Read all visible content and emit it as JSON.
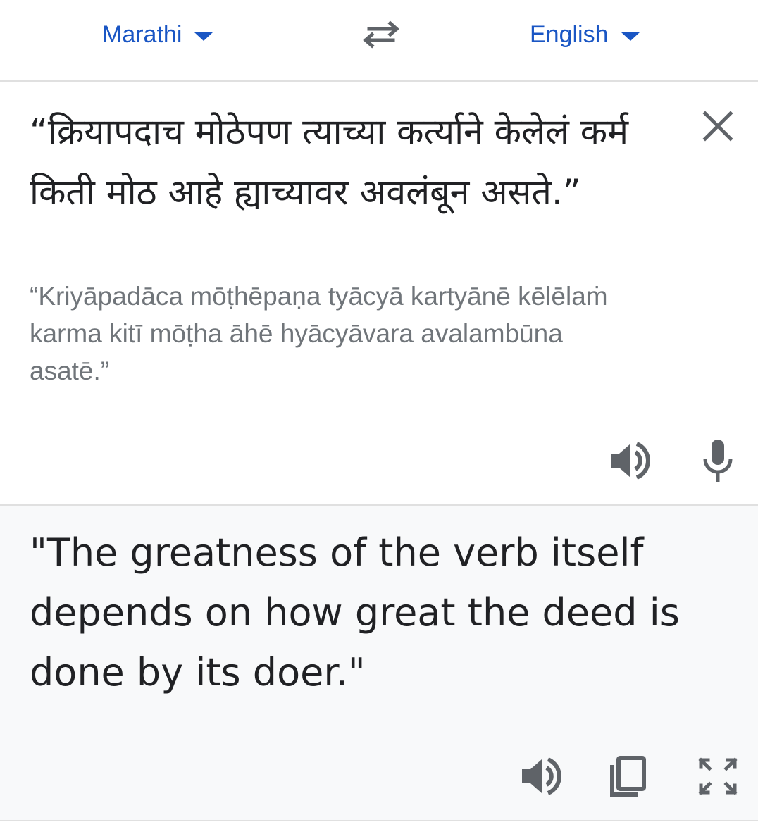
{
  "language_bar": {
    "source_language": "Marathi",
    "target_language": "English",
    "swap_icon": "swap-arrows-icon"
  },
  "source": {
    "text": "“क्रियापदाच मोठेपण त्याच्या कर्त्याने केलेलं कर्म किती मोठ आहे ह्याच्यावर अवलंबून असते.”",
    "transliteration": "“Kriyāpadāca mōṭhēpaṇa tyācyā kartyānē kēlēlaṁ karma kitī mōṭha āhē hyācyāvara avalambūna asatē.”",
    "icons": [
      "close-icon",
      "speaker-icon",
      "microphone-icon"
    ]
  },
  "result": {
    "text": "\"The greatness of the verb itself depends on how great the deed is done by its doer.\"",
    "icons": [
      "speaker-icon",
      "copy-icon",
      "fullscreen-icon"
    ]
  },
  "colors": {
    "accent": "#1a56c4",
    "text_primary": "#202124",
    "text_secondary": "#70757a",
    "icon": "#5f6368",
    "result_background": "#f8f9fa",
    "divider": "#e0e0e0"
  }
}
